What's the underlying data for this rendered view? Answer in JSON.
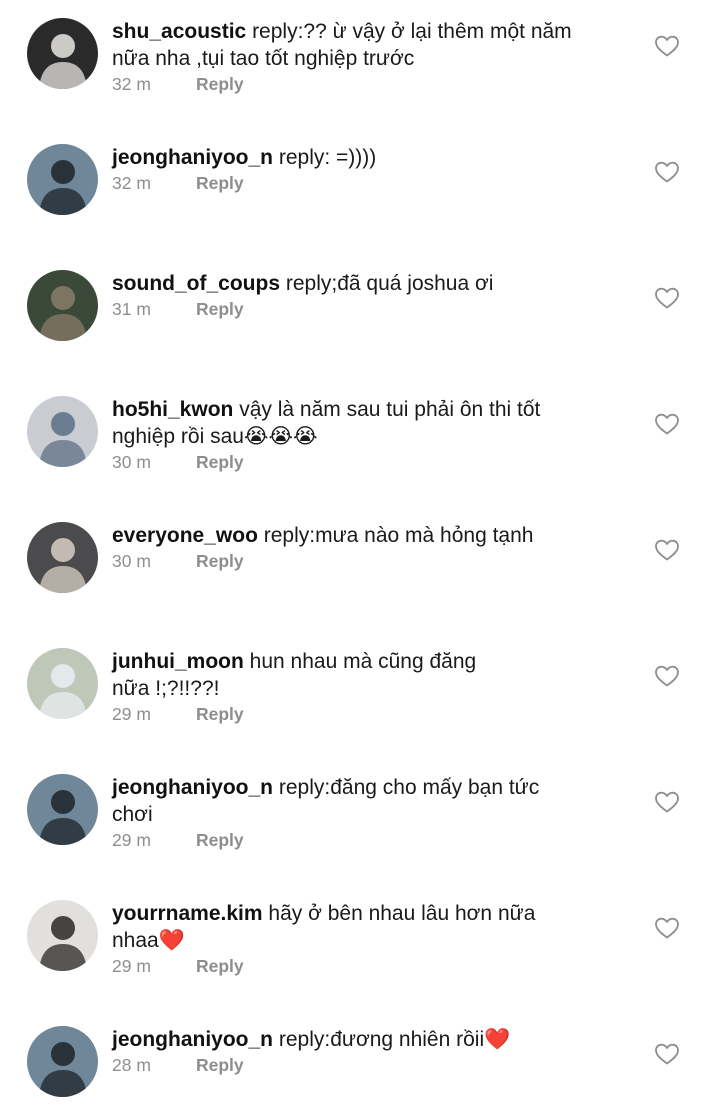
{
  "comments": [
    {
      "username": "shu_acoustic",
      "text": "reply:?? ừ vậy ở lại thêm một năm",
      "text2": "nữa nha ,tụi tao tốt nghiệp trước",
      "time": "32 m",
      "reply": "Reply",
      "avatar": {
        "bg": "#2a2a2a",
        "accent": "#e8e6e3"
      }
    },
    {
      "username": "jeonghaniyoo_n",
      "text": "reply: =))))",
      "text2": "",
      "time": "32 m",
      "reply": "Reply",
      "avatar": {
        "bg": "#6f8798",
        "accent": "#1e2328"
      }
    },
    {
      "username": "sound_of_coups",
      "text": "reply;đã quá joshua ơi",
      "text2": "",
      "time": "31 m",
      "reply": "Reply",
      "avatar": {
        "bg": "#3b4a38",
        "accent": "#8a7b6a"
      }
    },
    {
      "username": "ho5hi_kwon",
      "text": "vậy là năm sau tui phải ôn thi tốt",
      "text2": "nghiệp rồi sau😭😭😭",
      "time": "30 m",
      "reply": "Reply",
      "avatar": {
        "bg": "#c9cdd2",
        "accent": "#5d6f86"
      }
    },
    {
      "username": "everyone_woo",
      "text": "reply:mưa nào mà hỏng tạnh",
      "text2": "",
      "time": "30 m",
      "reply": "Reply",
      "avatar": {
        "bg": "#4b4b4d",
        "accent": "#d8cfc6"
      }
    },
    {
      "username": "junhui_moon",
      "text": "hun nhau mà cũng đăng",
      "text2": "nữa !;?!!??!",
      "time": "29 m",
      "reply": "Reply",
      "avatar": {
        "bg": "#bfc7b8",
        "accent": "#e9eef2"
      }
    },
    {
      "username": "jeonghaniyoo_n",
      "text": "reply:đăng cho mấy bạn tức",
      "text2": "chơi",
      "time": "29 m",
      "reply": "Reply",
      "avatar": {
        "bg": "#6f8798",
        "accent": "#1e2328"
      }
    },
    {
      "username": "yourrname.kim",
      "text": "hãy ở bên nhau lâu hơn nữa",
      "text2": "nhaa❤️",
      "time": "29 m",
      "reply": "Reply",
      "avatar": {
        "bg": "#e2e0dc",
        "accent": "#2a2724"
      }
    },
    {
      "username": "jeonghaniyoo_n",
      "text": "reply:đương nhiên rồii❤️",
      "text2": "",
      "time": "28 m",
      "reply": "Reply",
      "avatar": {
        "bg": "#6f8798",
        "accent": "#1e2328"
      }
    }
  ],
  "icons": {
    "avatar": "profile-photo",
    "like": "heart-outline-icon"
  },
  "colors": {
    "username": "#111111",
    "text": "#1a1a1a",
    "meta": "#8e8e8e",
    "like": "#8e8e8e"
  }
}
